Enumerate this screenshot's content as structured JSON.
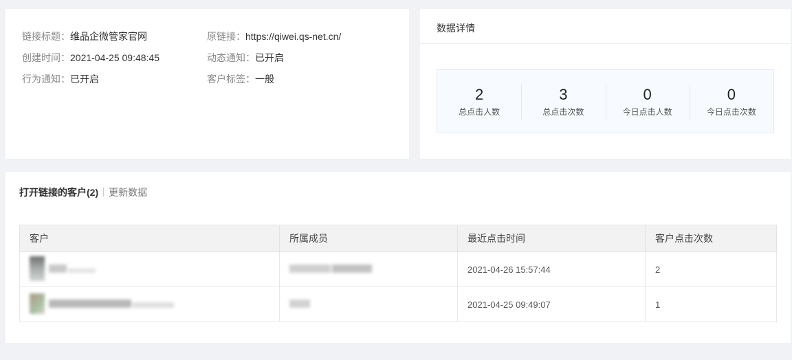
{
  "link_info": {
    "title_label": "链接标题：",
    "title_value": "维品企微管家官网",
    "url_label": "原链接：",
    "url_value": "https://qiwei.qs-net.cn/",
    "created_label": "创建时间：",
    "created_value": "2021-04-25 09:48:45",
    "dynamic_label": "动态通知：",
    "dynamic_value": "已开启",
    "behavior_label": "行为通知：",
    "behavior_value": "已开启",
    "tag_label": "客户标签：",
    "tag_value": "一般"
  },
  "stats": {
    "title": "数据详情",
    "items": [
      {
        "value": "2",
        "label": "总点击人数"
      },
      {
        "value": "3",
        "label": "总点击次数"
      },
      {
        "value": "0",
        "label": "今日点击人数"
      },
      {
        "value": "0",
        "label": "今日点击次数"
      }
    ]
  },
  "customers": {
    "title": "打开链接的客户(2)",
    "refresh_label": "更新数据",
    "columns": [
      "客户",
      "所属成员",
      "最近点击时间",
      "客户点击次数"
    ],
    "rows": [
      {
        "last_click": "2021-04-26 15:57:44",
        "count": "2"
      },
      {
        "last_click": "2021-04-25 09:49:07",
        "count": "1"
      }
    ]
  }
}
